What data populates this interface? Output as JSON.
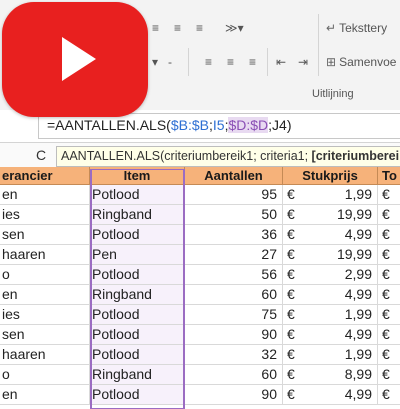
{
  "ribbon": {
    "wrap_text_label": "Teksttery",
    "merge_label": "Samenvoe",
    "alignment_group_label": "Uitlijning"
  },
  "formula": {
    "prefix": "=AANTALLEN.ALS(",
    "ref1": "$B:$B",
    "sep1": ";",
    "ref2": "I5",
    "sep2": ";",
    "ref3": "$D:$D",
    "sep3": ";",
    "ref4": "J4",
    "suffix": ")"
  },
  "hint": {
    "column_letter": "C",
    "text": "AANTALLEN.ALS(criteriumbereik1; criteria1; ",
    "bold_text": "[criteriumbereik2"
  },
  "table": {
    "headers": [
      "erancier",
      "Item",
      "Aantallen",
      "Stukprijs",
      "To"
    ],
    "currency_symbol": "€",
    "rows": [
      {
        "supplier": "en",
        "item": "Potlood",
        "qty": "95",
        "price": "1,99",
        "tot": "€"
      },
      {
        "supplier": "ies",
        "item": "Ringband",
        "qty": "50",
        "price": "19,99",
        "tot": "€"
      },
      {
        "supplier": "sen",
        "item": "Potlood",
        "qty": "36",
        "price": "4,99",
        "tot": "€"
      },
      {
        "supplier": "haaren",
        "item": "Pen",
        "qty": "27",
        "price": "19,99",
        "tot": "€"
      },
      {
        "supplier": "o",
        "item": "Potlood",
        "qty": "56",
        "price": "2,99",
        "tot": "€"
      },
      {
        "supplier": "en",
        "item": "Ringband",
        "qty": "60",
        "price": "4,99",
        "tot": "€"
      },
      {
        "supplier": "ies",
        "item": "Potlood",
        "qty": "75",
        "price": "1,99",
        "tot": "€"
      },
      {
        "supplier": "sen",
        "item": "Potlood",
        "qty": "90",
        "price": "4,99",
        "tot": "€"
      },
      {
        "supplier": "haaren",
        "item": "Potlood",
        "qty": "32",
        "item2": "",
        "price": "1,99",
        "tot": "€"
      },
      {
        "supplier": "o",
        "item": "Ringband",
        "qty": "60",
        "price": "8,99",
        "tot": "€"
      },
      {
        "supplier": "en",
        "item": "Potlood",
        "qty": "90",
        "price": "4,99",
        "tot": "€"
      }
    ]
  },
  "colors": {
    "header_orange": "#f6b27a",
    "youtube_red": "#e8201f",
    "ref_blue": "#2e6fd3",
    "ref_purple": "#8a4fb5"
  },
  "icons": [
    "youtube-logo-icon",
    "play-icon",
    "align-left-icon",
    "align-center-icon",
    "align-right-icon",
    "wrap-text-icon",
    "merge-icon",
    "indent-icon",
    "orientation-icon"
  ]
}
